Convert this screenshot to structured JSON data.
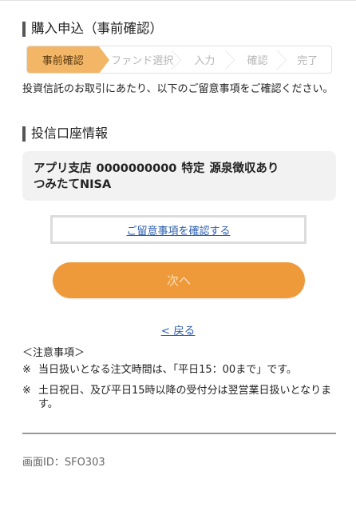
{
  "page": {
    "heading": "購入申込（事前確認）",
    "steps": [
      "事前確認",
      "ファンド選択",
      "入力",
      "確認",
      "完了"
    ],
    "active_step": 0,
    "intro": "投資信託のお取引にあたり、以下のご留意事項をご確認ください。"
  },
  "account": {
    "section_title": "投信口座情報",
    "branch": "アプリ支店",
    "number": "0000000000",
    "type": "特定",
    "tax": "源泉徴収あり",
    "nisa": "つみたてNISA"
  },
  "actions": {
    "confirm_link": "ご留意事項を確認する",
    "next_button": "次へ",
    "back_link": "< 戻る"
  },
  "notes": {
    "title": "＜注意事項＞",
    "items": [
      {
        "mark": "※",
        "text": "当日扱いとなる注文時間は、「平日15：00まで」です。"
      },
      {
        "mark": "※",
        "text": "土日祝日、及び平日15時以降の受付分は翌営業日扱いとなります。"
      }
    ]
  },
  "footer": {
    "screen_id": "画面ID：SFO303"
  },
  "colors": {
    "accent": "#ee9a3a",
    "active_step": "#f3b667",
    "link": "#2a5db0"
  }
}
